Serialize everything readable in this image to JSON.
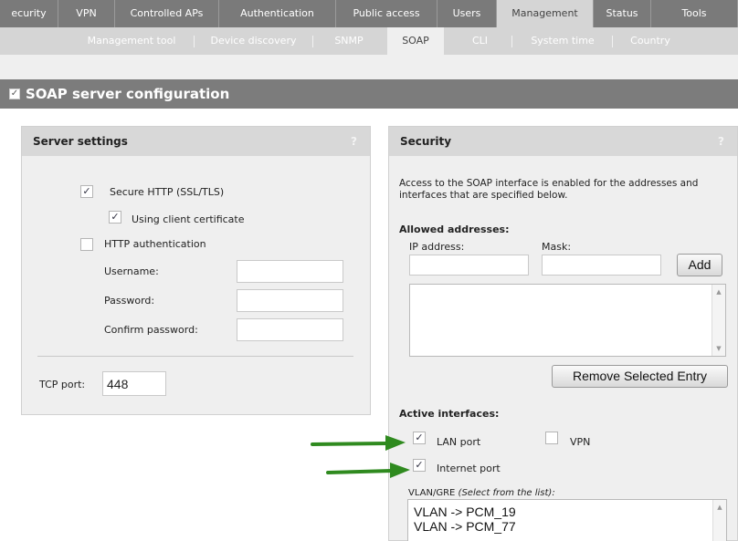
{
  "top_nav": [
    {
      "label": "ecurity"
    },
    {
      "label": "VPN"
    },
    {
      "label": "Controlled APs"
    },
    {
      "label": "Authentication"
    },
    {
      "label": "Public access"
    },
    {
      "label": "Users"
    },
    {
      "label": "Management",
      "active": true
    },
    {
      "label": "Status"
    },
    {
      "label": "Tools"
    }
  ],
  "sub_nav": [
    {
      "label": "Management tool"
    },
    {
      "label": "Device discovery"
    },
    {
      "label": "SNMP"
    },
    {
      "label": "SOAP",
      "active": true
    },
    {
      "label": "CLI"
    },
    {
      "label": "System time"
    },
    {
      "label": "Country"
    }
  ],
  "page_title": {
    "label": "SOAP server configuration",
    "checked": true
  },
  "server_settings": {
    "title": "Server settings",
    "help": "?",
    "secure_http": {
      "label": "Secure HTTP (SSL/TLS)",
      "checked": true
    },
    "client_cert": {
      "label": "Using client certificate",
      "checked": true
    },
    "http_auth": {
      "label": "HTTP authentication",
      "checked": false
    },
    "username_label": "Username:",
    "username_value": "",
    "password_label": "Password:",
    "password_value": "",
    "confirm_label": "Confirm password:",
    "confirm_value": "",
    "tcp_port_label": "TCP port:",
    "tcp_port_value": "448"
  },
  "security": {
    "title": "Security",
    "help": "?",
    "description": "Access to the SOAP interface is enabled for the addresses and interfaces that are specified below.",
    "allowed_title": "Allowed addresses:",
    "ip_label": "IP address:",
    "ip_value": "",
    "mask_label": "Mask:",
    "mask_value": "",
    "add_button": "Add",
    "remove_button": "Remove Selected Entry",
    "active_title": "Active interfaces:",
    "lan_port": {
      "label": "LAN port",
      "checked": true
    },
    "vpn": {
      "label": "VPN",
      "checked": false
    },
    "internet_port": {
      "label": "Internet port",
      "checked": true
    },
    "vlan_label": "VLAN/GRE",
    "vlan_hint": "(Select from the list):",
    "vlan_items": [
      "VLAN -> PCM_19",
      "VLAN -> PCM_77"
    ]
  },
  "colors": {
    "nav_dark": "#7a7a7a",
    "nav_light": "#d5d5d5",
    "panel_bg": "#efefef",
    "arrow_green": "#2f8a1f"
  },
  "icons": {
    "checked": "✓",
    "arrow": "right-arrow-icon"
  }
}
